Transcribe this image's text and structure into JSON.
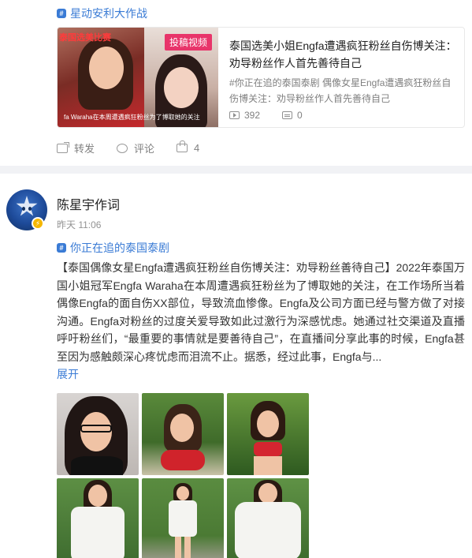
{
  "repost": {
    "topic_tag": "星动安利大作战",
    "video": {
      "thumb_label": "泰国选美比赛",
      "badge": "投稿视频",
      "caption": "fa Waraha在本周遭遇疯狂粉丝为了博取她的关注",
      "title": "泰国选美小姐Engfa遭遇疯狂粉丝自伤博关注：劝导粉丝作人首先善待自己",
      "desc": "#你正在追的泰国泰剧 偶像女星Engfa遭遇疯狂粉丝自伤博关注：劝导粉丝作人首先善待自己",
      "views": "392",
      "comments": "0"
    },
    "actions": {
      "share_label": "转发",
      "comment_label": "评论",
      "like_count": "4"
    }
  },
  "post": {
    "username": "陈星宇作词",
    "time": "昨天 11:06",
    "topic_tag": "你正在追的泰国泰剧",
    "text": "【泰国偶像女星Engfa遭遇疯狂粉丝自伤博关注：劝导粉丝善待自己】2022年泰国万国小姐冠军Engfa Waraha在本周遭遇疯狂粉丝为了博取她的关注，在工作场所当着偶像Engfa的面自伤XX部位，导致流血惨像。Engfa及公司方面已经与警方做了对接沟通。Engfa对粉丝的过度关爱导致如此过激行为深感忧虑。她通过社交渠道及直播呼吁粉丝们，“最重要的事情就是要善待自己”，在直播间分享此事的时候，Engfa甚至因为感触颇深心疼忧虑而泪流不止。据悉，经过此事，Engfa与...",
    "expand_label": "展开",
    "photos": [
      "photo-1",
      "photo-2",
      "photo-3",
      "photo-4",
      "photo-5",
      "photo-6"
    ]
  },
  "colors": {
    "link_blue": "#3a7bd5",
    "muted_gray": "#808080",
    "divider_gray": "#f1f2f5",
    "badge_pink": "#e8346a",
    "verify_gold": "#f5b700"
  }
}
